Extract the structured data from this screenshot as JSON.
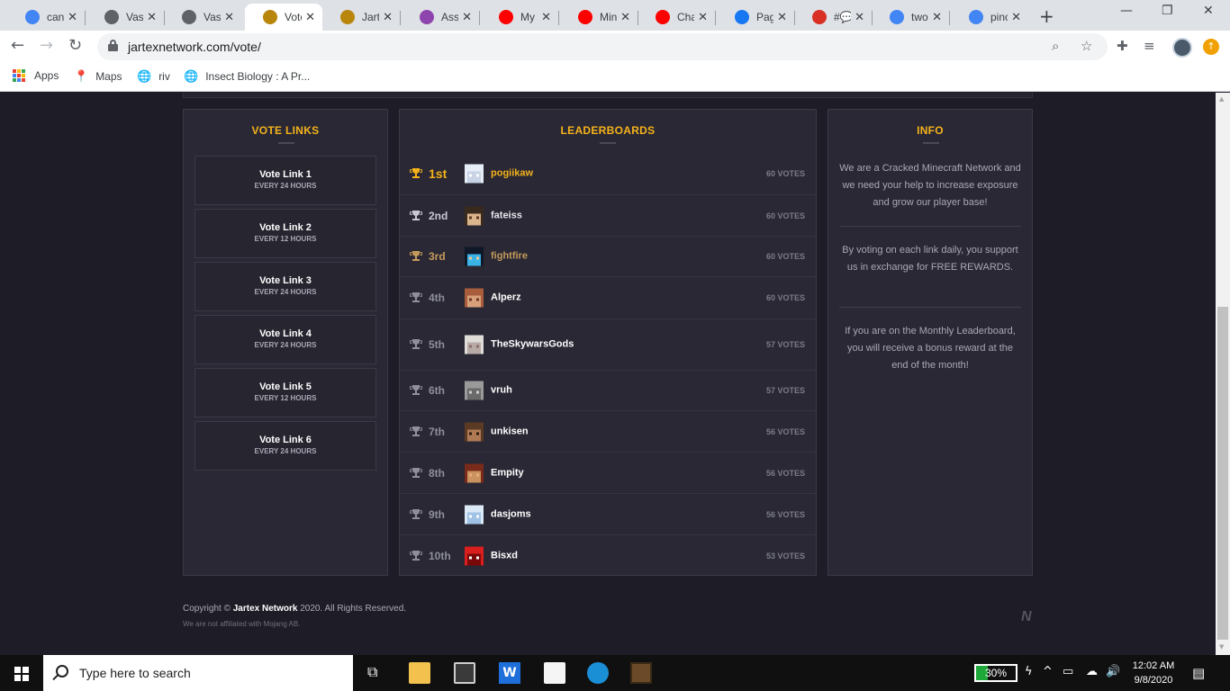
{
  "browser": {
    "tabs": [
      {
        "label": "cann",
        "favicon": "google-icon",
        "color": "#4285f4"
      },
      {
        "label": "Vasc",
        "favicon": "globe-icon",
        "color": "#5f6368"
      },
      {
        "label": "Vasc",
        "favicon": "globe-icon",
        "color": "#5f6368"
      },
      {
        "label": "Vote",
        "favicon": "jartex-icon",
        "color": "#b8860b",
        "active": true
      },
      {
        "label": "Jarte",
        "favicon": "jartex-icon",
        "color": "#b8860b"
      },
      {
        "label": "Assi",
        "favicon": "assignment-icon",
        "color": "#8e44ad"
      },
      {
        "label": "My r",
        "favicon": "youtube-icon",
        "color": "#ff0000"
      },
      {
        "label": "Mine",
        "favicon": "youtube-icon",
        "color": "#ff0000"
      },
      {
        "label": "Char",
        "favicon": "youtube-icon",
        "color": "#ff0000"
      },
      {
        "label": "Page",
        "favicon": "facebook-icon",
        "color": "#1877f2"
      },
      {
        "label": "#💬",
        "favicon": "calendar-badge-icon",
        "color": "#d93025"
      },
      {
        "label": "two",
        "favicon": "google-icon",
        "color": "#4285f4"
      },
      {
        "label": "pinc",
        "favicon": "google-icon",
        "color": "#4285f4"
      }
    ],
    "url": "jartexnetwork.com/vote/",
    "bookmarks": [
      {
        "label": "Apps",
        "icon": "apps-grid-icon"
      },
      {
        "label": "Maps",
        "icon": "maps-pin-icon"
      },
      {
        "label": "riv",
        "icon": "globe-icon"
      },
      {
        "label": "Insect Biology : A Pr...",
        "icon": "globe-icon"
      }
    ]
  },
  "vote_links": {
    "title": "VOTE LINKS",
    "items": [
      {
        "name": "Vote Link 1",
        "frequency": "EVERY 24 HOURS"
      },
      {
        "name": "Vote Link 2",
        "frequency": "EVERY 12 HOURS"
      },
      {
        "name": "Vote Link 3",
        "frequency": "EVERY 24 HOURS"
      },
      {
        "name": "Vote Link 4",
        "frequency": "EVERY 24 HOURS"
      },
      {
        "name": "Vote Link 5",
        "frequency": "EVERY 12 HOURS"
      },
      {
        "name": "Vote Link 6",
        "frequency": "EVERY 24 HOURS"
      }
    ]
  },
  "leaderboard": {
    "title": "LEADERBOARDS",
    "rows": [
      {
        "rank": "1st",
        "player": "pogiikaw",
        "votes": "60 VOTES",
        "rank_color": "#f5b21b",
        "name_color": "#f5b21b"
      },
      {
        "rank": "2nd",
        "player": "fateiss",
        "votes": "60 VOTES",
        "rank_color": "#c9c9d4",
        "name_color": "#e6e6ee"
      },
      {
        "rank": "3rd",
        "player": "fightfire",
        "votes": "60 VOTES",
        "rank_color": "#c49a5c",
        "name_color": "#c49a5c"
      },
      {
        "rank": "4th",
        "player": "Alperz",
        "votes": "60 VOTES",
        "rank_color": "#8f8e9c",
        "name_color": "#ffffff"
      },
      {
        "rank": "5th",
        "player": "TheSkywarsGods",
        "votes": "57 VOTES",
        "rank_color": "#8f8e9c",
        "name_color": "#ffffff"
      },
      {
        "rank": "6th",
        "player": "vruh",
        "votes": "57 VOTES",
        "rank_color": "#8f8e9c",
        "name_color": "#ffffff"
      },
      {
        "rank": "7th",
        "player": "unkisen",
        "votes": "56 VOTES",
        "rank_color": "#8f8e9c",
        "name_color": "#ffffff"
      },
      {
        "rank": "8th",
        "player": "Empity",
        "votes": "56 VOTES",
        "rank_color": "#8f8e9c",
        "name_color": "#ffffff"
      },
      {
        "rank": "9th",
        "player": "dasjoms",
        "votes": "56 VOTES",
        "rank_color": "#8f8e9c",
        "name_color": "#ffffff"
      },
      {
        "rank": "10th",
        "player": "Bisxd",
        "votes": "53 VOTES",
        "rank_color": "#8f8e9c",
        "name_color": "#ffffff"
      }
    ]
  },
  "info": {
    "title": "INFO",
    "paragraphs": [
      "We are a Cracked Minecraft Network and we need your help to increase exposure and grow our player base!",
      "By voting on each link daily, you support us in exchange for FREE REWARDS.",
      "If you are on the Monthly Leaderboard, you will receive a bonus reward at the end of the month!"
    ]
  },
  "footer": {
    "copyright_prefix": "Copyright © ",
    "brand": "Jartex Network",
    "copyright_suffix": " 2020. All Rights Reserved.",
    "disclaimer": "We are not affiliated with Mojang AB.",
    "logo": "N"
  },
  "taskbar": {
    "search_placeholder": "Type here to search",
    "battery": "30%",
    "battery_level": 0.3,
    "time": "12:02 AM",
    "date": "9/8/2020"
  },
  "colors": {
    "accent": "#f5b21b",
    "page_bg": "#1e1d27",
    "panel_bg": "#292834"
  }
}
